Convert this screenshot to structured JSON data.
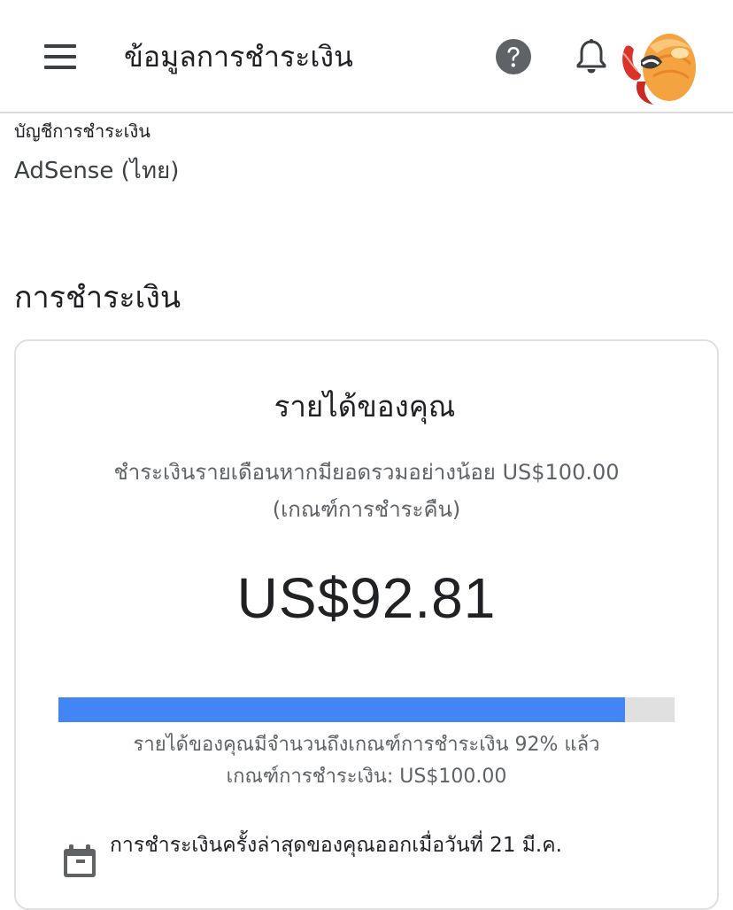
{
  "header": {
    "title": "ข้อมูลการชำระเงิน",
    "menu_icon": "menu-icon",
    "help_icon": "help-icon",
    "notification_icon": "bell-icon",
    "avatar_icon": "avatar"
  },
  "account": {
    "label": "บัญชีการชำระเงิน",
    "value": "AdSense (ไทย)"
  },
  "payments": {
    "title": "การชำระเงิน",
    "card": {
      "heading": "รายได้ของคุณ",
      "subtitle": "ชำระเงินรายเดือนหากมียอดรวมอย่างน้อย US$100.00",
      "threshold_link": "(เกณฑ์การชำระคืน)",
      "amount": "US$92.81",
      "progress_fraction": 0.92,
      "progress_text": "รายได้ของคุณมีจำนวนถึงเกณฑ์การชำระเงิน 92% แล้ว",
      "threshold_text": "เกณฑ์การชำระเงิน: US$100.00",
      "last_payment_text": "การชำระเงินครั้งล่าสุดของคุณออกเมื่อวันที่ 21 มี.ค.",
      "calendar_icon": "calendar-icon"
    }
  },
  "colors": {
    "progress_fill": "#4285f4",
    "progress_track": "#e0e0e0",
    "icon_dark": "#3c4043",
    "secondary_text": "#5f6368"
  }
}
